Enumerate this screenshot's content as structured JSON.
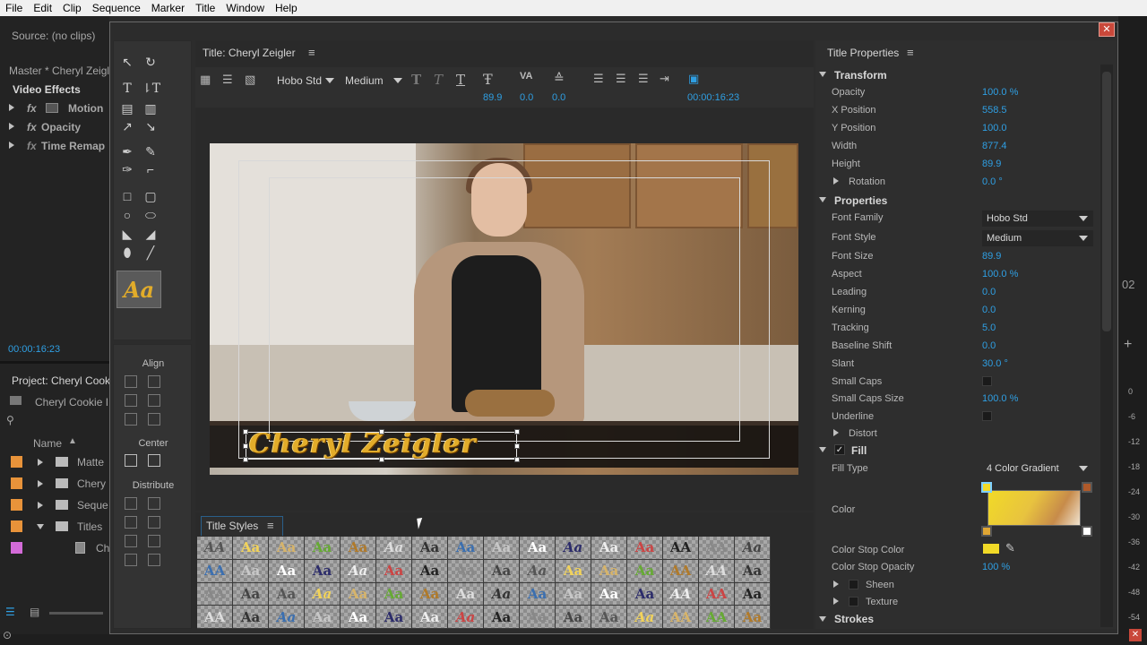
{
  "menu": [
    "File",
    "Edit",
    "Clip",
    "Sequence",
    "Marker",
    "Title",
    "Window",
    "Help"
  ],
  "background": {
    "source_label": "Source: (no clips)",
    "master_label": "Master * Cheryl Zeigl",
    "video_effects": "Video Effects",
    "effects": [
      "Motion",
      "Opacity",
      "Time Remap"
    ],
    "timecode": "00:00:16:23",
    "project_label": "Project: Cheryl Cook",
    "project_file": "Cheryl Cookie I",
    "name_header": "Name",
    "bins": [
      "Matte",
      "Chery",
      "Seque",
      "Titles",
      "Ch"
    ],
    "right_number": "02",
    "meter_ticks": [
      "0",
      "-6",
      "-12",
      "-18",
      "-24",
      "-30",
      "-36",
      "-42",
      "-48",
      "-54"
    ]
  },
  "title_panel": {
    "tab": "Title: Cheryl Zeigler",
    "font_family": "Hobo Std",
    "font_style": "Medium",
    "size_value": "89.9",
    "kerning_value": "0.0",
    "leading_value": "0.0",
    "timecode": "00:00:16:23",
    "title_text": "Cheryl Zeigler"
  },
  "align_panel": {
    "align": "Align",
    "center": "Center",
    "distribute": "Distribute"
  },
  "title_styles": {
    "tab": "Title Styles",
    "swatch_text": "Aa",
    "swatch_variants": [
      "AA",
      "Aa",
      "Aa",
      "Aa",
      "Aa",
      "Aa",
      "Aa",
      "Aa",
      "Aa",
      "Aa",
      "Aa",
      "Aa",
      "Aa",
      "AA",
      "AA",
      "Aa"
    ]
  },
  "properties": {
    "tab": "Title Properties",
    "transform": "Transform",
    "opacity_label": "Opacity",
    "opacity": "100.0 %",
    "xpos_label": "X Position",
    "xpos": "558.5",
    "ypos_label": "Y Position",
    "ypos": "100.0",
    "width_label": "Width",
    "width": "877.4",
    "height_label": "Height",
    "height": "89.9",
    "rotation_label": "Rotation",
    "rotation": "0.0 °",
    "properties_section": "Properties",
    "font_family_label": "Font Family",
    "font_family": "Hobo Std",
    "font_style_label": "Font Style",
    "font_style": "Medium",
    "font_size_label": "Font Size",
    "font_size": "89.9",
    "aspect_label": "Aspect",
    "aspect": "100.0 %",
    "leading_label": "Leading",
    "leading": "0.0",
    "kerning_label": "Kerning",
    "kerning": "0.0",
    "tracking_label": "Tracking",
    "tracking": "5.0",
    "baseline_label": "Baseline Shift",
    "baseline": "0.0",
    "slant_label": "Slant",
    "slant": "30.0 °",
    "small_caps_label": "Small Caps",
    "small_caps_size_label": "Small Caps Size",
    "small_caps_size": "100.0 %",
    "underline_label": "Underline",
    "distort_label": "Distort",
    "fill_section": "Fill",
    "fill_type_label": "Fill Type",
    "fill_type": "4 Color Gradient",
    "color_label": "Color",
    "color_stop_color_label": "Color Stop Color",
    "color_stop_opacity_label": "Color Stop Opacity",
    "color_stop_opacity": "100 %",
    "sheen_label": "Sheen",
    "texture_label": "Texture",
    "strokes_section": "Strokes"
  },
  "colors": {
    "accent_blue": "#2f9fe3",
    "title_gold": "#e2ac2a",
    "close_red": "#c9483a",
    "stop_color": "#f1da27"
  }
}
